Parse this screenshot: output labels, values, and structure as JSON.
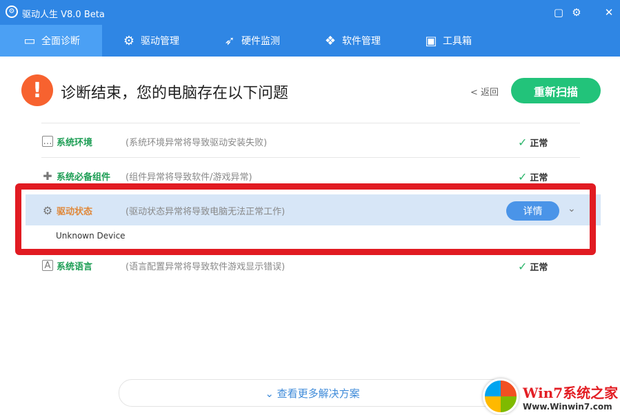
{
  "window": {
    "title": "驱动人生 V8.0 Beta",
    "logo_glyph": "⚙",
    "buttons": {
      "feedback": "▢",
      "settings": "⚙",
      "close": "✕"
    }
  },
  "nav": {
    "tabs": [
      {
        "label": "全面诊断",
        "icon": "monitor-pulse-icon",
        "glyph": "▭",
        "active": true
      },
      {
        "label": "驱动管理",
        "icon": "gear-icon",
        "glyph": "⚙",
        "active": false
      },
      {
        "label": "硬件监测",
        "icon": "rocket-icon",
        "glyph": "➶",
        "active": false
      },
      {
        "label": "软件管理",
        "icon": "apps-icon",
        "glyph": "❖",
        "active": false
      },
      {
        "label": "工具箱",
        "icon": "toolbox-icon",
        "glyph": "▣",
        "active": false
      }
    ]
  },
  "header": {
    "alert_glyph": "!",
    "headline": "诊断结束，您的电脑存在以下问题",
    "back_label": "< 返回",
    "rescan_label": "重新扫描"
  },
  "rows": [
    {
      "name": "系统环境",
      "desc": "(系统环境异常将导致驱动安装失败)",
      "status": "正常",
      "icon_glyph": "…"
    },
    {
      "name": "系统必备组件",
      "desc": "(组件异常将导致软件/游戏异常)",
      "status": "正常",
      "icon_glyph": "✚"
    },
    {
      "name": "驱动状态",
      "desc": "(驱动状态异常将导致电脑无法正常工作)",
      "detail_label": "详情",
      "icon_glyph": "⚙",
      "sub_item": "Unknown Device"
    },
    {
      "name": "系统语言",
      "desc": "(语言配置异常将导致软件游戏显示错误)",
      "status": "正常",
      "icon_glyph": "A"
    }
  ],
  "status_check_glyph": "✓",
  "chevron_glyph": "⌄",
  "more_solutions": "⌄ 查看更多解决方案",
  "watermark": {
    "title": "Win7系统之家",
    "url": "Www.Winwin7.com"
  },
  "colors": {
    "brand_blue": "#2f86e4",
    "active_tab": "#4ba0f4",
    "rescan_green": "#22c37a",
    "alert_orange": "#f7622f",
    "highlight_red": "#e11b22"
  }
}
